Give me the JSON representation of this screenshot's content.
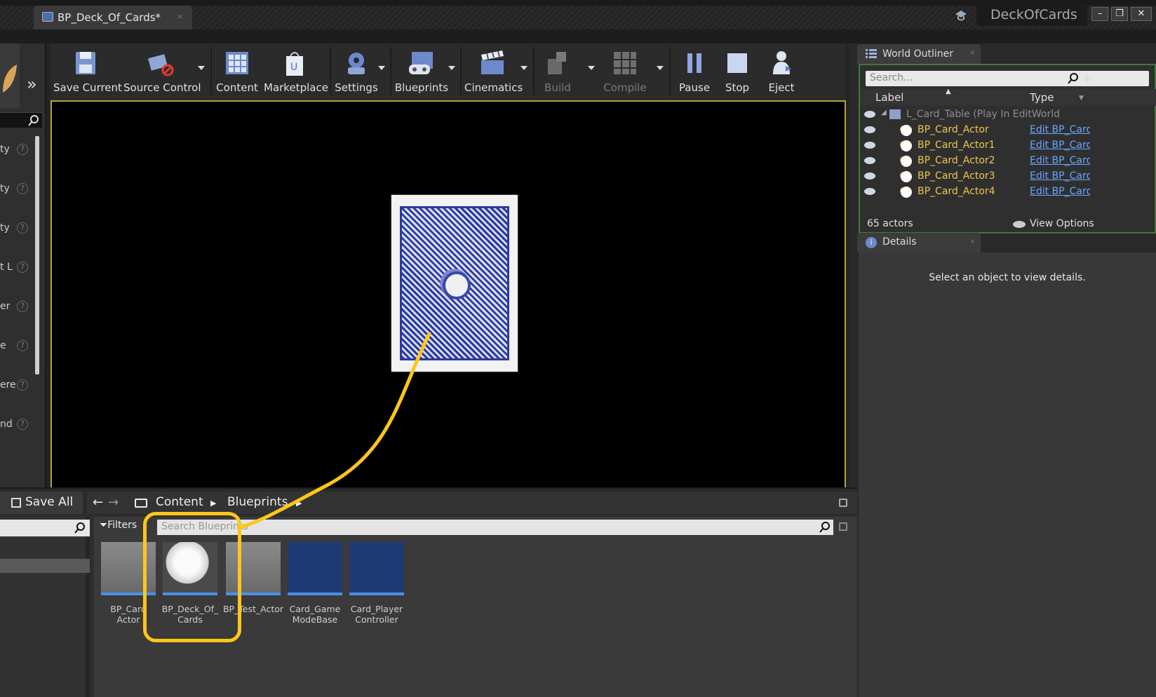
{
  "titlebar": {
    "tab_title": "BP_Deck_Of_Cards*",
    "tab_close": "×",
    "project_name": "DeckOfCards",
    "min": "–",
    "max": "❐",
    "close": "✕"
  },
  "toolbar": {
    "buttons": [
      {
        "label": "Save Current"
      },
      {
        "label": "Source Control"
      },
      {
        "label": "Content"
      },
      {
        "label": "Marketplace"
      },
      {
        "label": "Settings"
      },
      {
        "label": "Blueprints"
      },
      {
        "label": "Cinematics"
      },
      {
        "label": "Build"
      },
      {
        "label": "Compile"
      },
      {
        "label": "Pause"
      },
      {
        "label": "Stop"
      },
      {
        "label": "Eject"
      }
    ],
    "overflow": "»"
  },
  "left_panel": {
    "rows": [
      "ty",
      "ty",
      "ty",
      "t L",
      "er",
      "e",
      "ere",
      "nd"
    ],
    "help": "?"
  },
  "outliner": {
    "tab": "World Outliner",
    "tab_close": "×",
    "search_placeholder": "Search...",
    "col_label": "Label",
    "col_type": "Type",
    "root": "L_Card_Table (Play In EditWorld",
    "rows": [
      {
        "label": "BP_Card_Actor",
        "type": "Edit BP_Card_Actor"
      },
      {
        "label": "BP_Card_Actor1",
        "type": "Edit BP_Card_Actor"
      },
      {
        "label": "BP_Card_Actor2",
        "type": "Edit BP_Card_Actor"
      },
      {
        "label": "BP_Card_Actor3",
        "type": "Edit BP_Card_Actor"
      },
      {
        "label": "BP_Card_Actor4",
        "type": "Edit BP_Card_Actor"
      }
    ],
    "count": "65 actors",
    "view_options": "View Options"
  },
  "details": {
    "tab": "Details",
    "tab_close": "×",
    "message": "Select an object to view details."
  },
  "content_browser": {
    "save_all": "Save All",
    "path": [
      "Content",
      "Blueprints"
    ],
    "filters": "Filters",
    "search_placeholder": "Search Blueprints",
    "assets": [
      {
        "line1": "BP_Card",
        "line2": "Actor"
      },
      {
        "line1": "BP_Deck_Of_",
        "line2": "Cards"
      },
      {
        "line1": "BP_Test_Actor",
        "line2": ""
      },
      {
        "line1": "Card_Game",
        "line2": "ModeBase"
      },
      {
        "line1": "Card_Player",
        "line2": "Controller"
      }
    ]
  },
  "colors": {
    "highlight": "#ffc61a",
    "viewport_border": "#b8a23a",
    "outliner_label": "#f0c64a",
    "link": "#6aa7ff"
  }
}
